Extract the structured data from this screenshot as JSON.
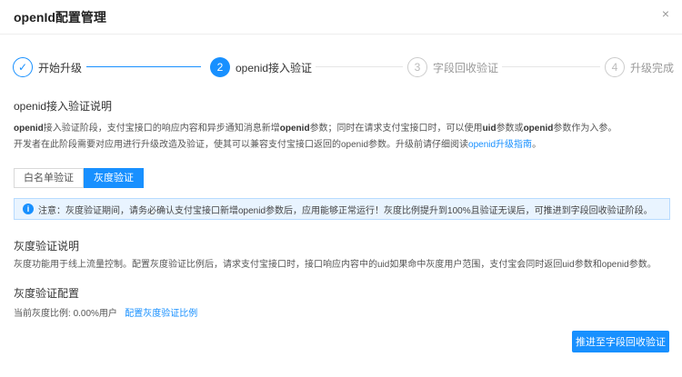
{
  "dialog": {
    "title": "openId配置管理",
    "close_glyph": "×"
  },
  "steps": [
    {
      "index": "✓",
      "label": "开始升级",
      "status": "done"
    },
    {
      "index": "2",
      "label": "openid接入验证",
      "status": "active"
    },
    {
      "index": "3",
      "label": "字段回收验证",
      "status": "wait"
    },
    {
      "index": "4",
      "label": "升级完成",
      "status": "wait"
    }
  ],
  "intro": {
    "title": "openid接入验证说明",
    "line1_bold_start": "openid",
    "line1_a": "接入验证阶段，支付宝接口的响应内容和异步通知消息新增",
    "line1_bold_mid": "openid",
    "line1_b": "参数；同时在请求支付宝接口时，可以使用",
    "line1_bold_uid": "uid",
    "line1_c": "参数或",
    "line1_bold_openid2": "openid",
    "line1_d": "参数作为入参。",
    "line2": "开发者在此阶段需要对应用进行升级改造及验证，使其可以兼容支付宝接口返回的openid参数。升级前请仔细阅读",
    "line2_link": "openid升级指南",
    "line2_end": "。"
  },
  "tabs": [
    {
      "label": "白名单验证",
      "active": false
    },
    {
      "label": "灰度验证",
      "active": true
    }
  ],
  "notice": {
    "icon": "i",
    "text": "注意：灰度验证期间，请务必确认支付宝接口新增openid参数后，应用能够正常运行！灰度比例提升到100%且验证无误后，可推进到字段回收验证阶段。"
  },
  "gray_desc": {
    "title": "灰度验证说明",
    "text": "灰度功能用于线上流量控制。配置灰度验证比例后，请求支付宝接口时，接口响应内容中的uid如果命中灰度用户范围，支付宝会同时返回uid参数和openid参数。"
  },
  "gray_config": {
    "title": "灰度验证配置",
    "ratio_label": "当前灰度比例:",
    "ratio_value": "0.00%用户",
    "config_link": "配置灰度验证比例"
  },
  "footer": {
    "advance_button": "推进至字段回收验证"
  },
  "colors": {
    "accent": "#1890ff",
    "notice_bg": "#e9f4ff"
  }
}
